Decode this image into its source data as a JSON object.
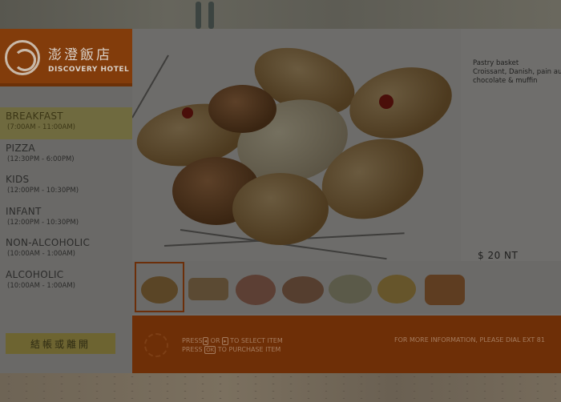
{
  "hotel": {
    "name_cn": "澎澄飯店",
    "name_en": "DISCOVERY HOTEL"
  },
  "menu": [
    {
      "name": "BREAKFAST",
      "hours": "(7:00AM - 11:00AM)",
      "active": true
    },
    {
      "name": "PIZZA",
      "hours": "(12:30PM - 6:00PM)",
      "active": false
    },
    {
      "name": "KIDS",
      "hours": "(12:00PM - 10:30PM)",
      "active": false
    },
    {
      "name": "INFANT",
      "hours": "(12:00PM - 10:30PM)",
      "active": false
    },
    {
      "name": "NON-ALCOHOLIC",
      "hours": "(10:00AM - 1:00AM)",
      "active": false
    },
    {
      "name": "ALCOHOLIC",
      "hours": "(10:00AM - 1:00AM)",
      "active": false
    }
  ],
  "checkout_label": "結帳或離開",
  "item": {
    "name": "Pastry basket",
    "description": "Croissant, Danish, pain au chocolate & muffin",
    "price": "$ 20 NT"
  },
  "thumbnails": [
    {
      "label": "pastry-basket",
      "selected": true
    },
    {
      "label": "bread-sticks",
      "selected": false
    },
    {
      "label": "cold-cuts",
      "selected": false
    },
    {
      "label": "salad-plate",
      "selected": false
    },
    {
      "label": "wrap",
      "selected": false
    },
    {
      "label": "fruit-plate",
      "selected": false
    },
    {
      "label": "waffle-set",
      "selected": false
    }
  ],
  "help": {
    "line1_prefix": "PRESS",
    "line1_key1": "◂",
    "line1_mid": "OR",
    "line1_key2": "▸",
    "line1_suffix": "TO SELECT ITEM",
    "line2_prefix": "PRESS",
    "line2_key": "OK",
    "line2_suffix": "TO PURCHASE ITEM",
    "info": "FOR MORE INFORMATION, PLEASE DIAL EXT 81"
  },
  "colors": {
    "brand_orange": "#823c0b",
    "active_yellow": "#6f6a3f"
  }
}
